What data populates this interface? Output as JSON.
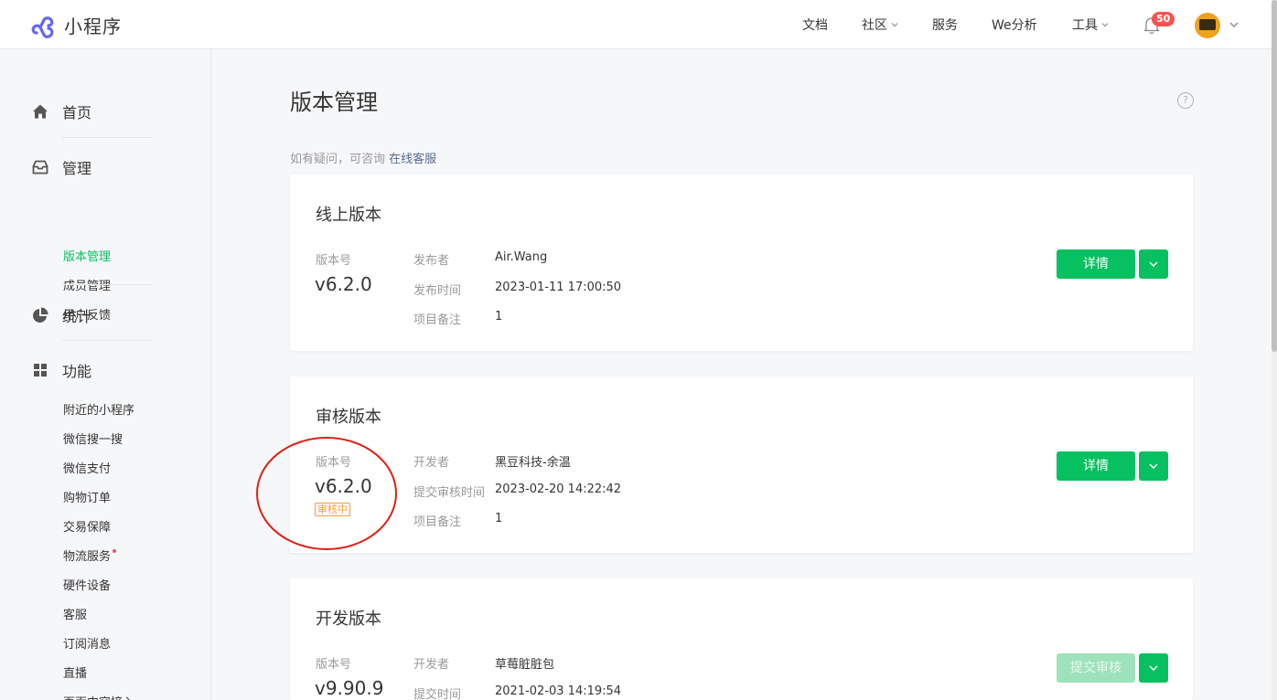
{
  "app": {
    "title": "小程序"
  },
  "nav": [
    {
      "label": "文档",
      "has_dropdown": false
    },
    {
      "label": "社区",
      "has_dropdown": true
    },
    {
      "label": "服务",
      "has_dropdown": false
    },
    {
      "label": "We分析",
      "has_dropdown": false
    },
    {
      "label": "工具",
      "has_dropdown": true
    }
  ],
  "notifications": {
    "count": "50"
  },
  "sidebar": {
    "groups": [
      {
        "label": "首页",
        "icon": "home-icon"
      },
      {
        "label": "管理",
        "icon": "inbox-icon"
      },
      {
        "label": "统计",
        "icon": "pie-chart-icon"
      },
      {
        "label": "功能",
        "icon": "grid-icon"
      }
    ],
    "manage_items": [
      "版本管理",
      "成员管理",
      "用户反馈"
    ],
    "function_items": [
      "附近的小程序",
      "微信搜一搜",
      "微信支付",
      "购物订单",
      "交易保障",
      "物流服务",
      "硬件设备",
      "客服",
      "订阅消息",
      "直播",
      "页面内容接入"
    ],
    "active_item": "版本管理"
  },
  "main": {
    "title": "版本管理",
    "hint_text": "如有疑问，可咨询",
    "hint_link": "在线客服",
    "cards": [
      {
        "title": "线上版本",
        "version_label": "版本号",
        "version": "v6.2.0",
        "fields": [
          {
            "label": "发布者",
            "value": "Air.Wang"
          },
          {
            "label": "发布时间",
            "value": "2023-01-11 17:00:50"
          },
          {
            "label": "项目备注",
            "value": "1"
          }
        ],
        "button": "详情"
      },
      {
        "title": "审核版本",
        "version_label": "版本号",
        "version": "v6.2.0",
        "status_tag": "审核中",
        "fields": [
          {
            "label": "开发者",
            "value": "黑豆科技-余温"
          },
          {
            "label": "提交审核时间",
            "value": "2023-02-20 14:22:42"
          },
          {
            "label": "项目备注",
            "value": "1"
          }
        ],
        "button": "详情"
      },
      {
        "title": "开发版本",
        "version_label": "版本号",
        "version": "v9.90.9",
        "fields": [
          {
            "label": "开发者",
            "value": "草莓脏脏包"
          },
          {
            "label": "提交时间",
            "value": "2021-02-03 14:19:54"
          }
        ],
        "button": "提交审核",
        "button_disabled": true
      }
    ]
  },
  "colors": {
    "brand": "#07c160",
    "annotation": "#e11d12",
    "badge": "#fa5151",
    "tag": "#fa9d3b",
    "link": "#576b95"
  }
}
